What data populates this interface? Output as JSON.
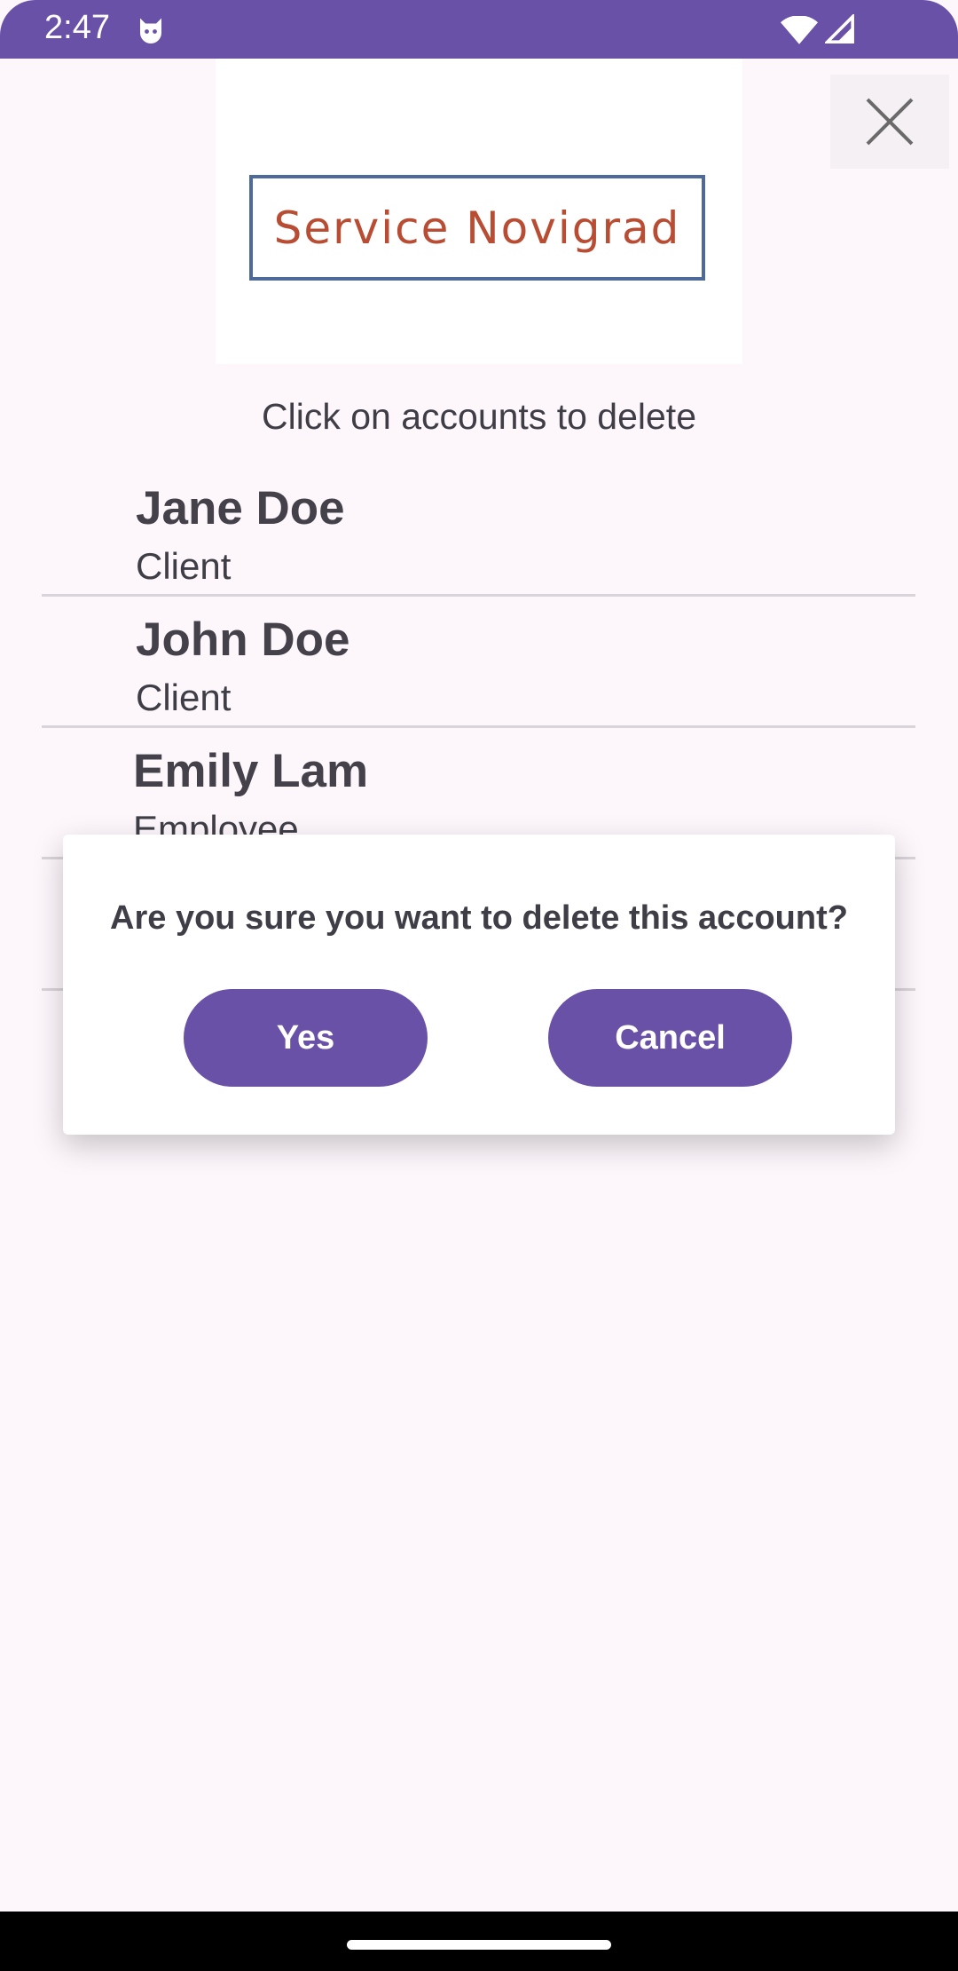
{
  "status_bar": {
    "time": "2:47",
    "icons": [
      "cat-face-icon",
      "wifi-icon",
      "signal-icon"
    ]
  },
  "header": {
    "logo_text": "Service Novigrad",
    "close_icon": "close-icon"
  },
  "instruction": "Click on accounts to delete",
  "accounts": [
    {
      "name": "Jane Doe",
      "role": "Client"
    },
    {
      "name": "John Doe",
      "role": "Client"
    },
    {
      "name": "Emily Lam",
      "role": "Employee"
    }
  ],
  "dialog": {
    "message": "Are you sure you want to delete this account?",
    "yes_label": "Yes",
    "cancel_label": "Cancel"
  },
  "colors": {
    "primary": "#6851a6",
    "background": "#fdf7fc",
    "logo_text": "#b84d33",
    "logo_border": "#4d6a9a"
  }
}
